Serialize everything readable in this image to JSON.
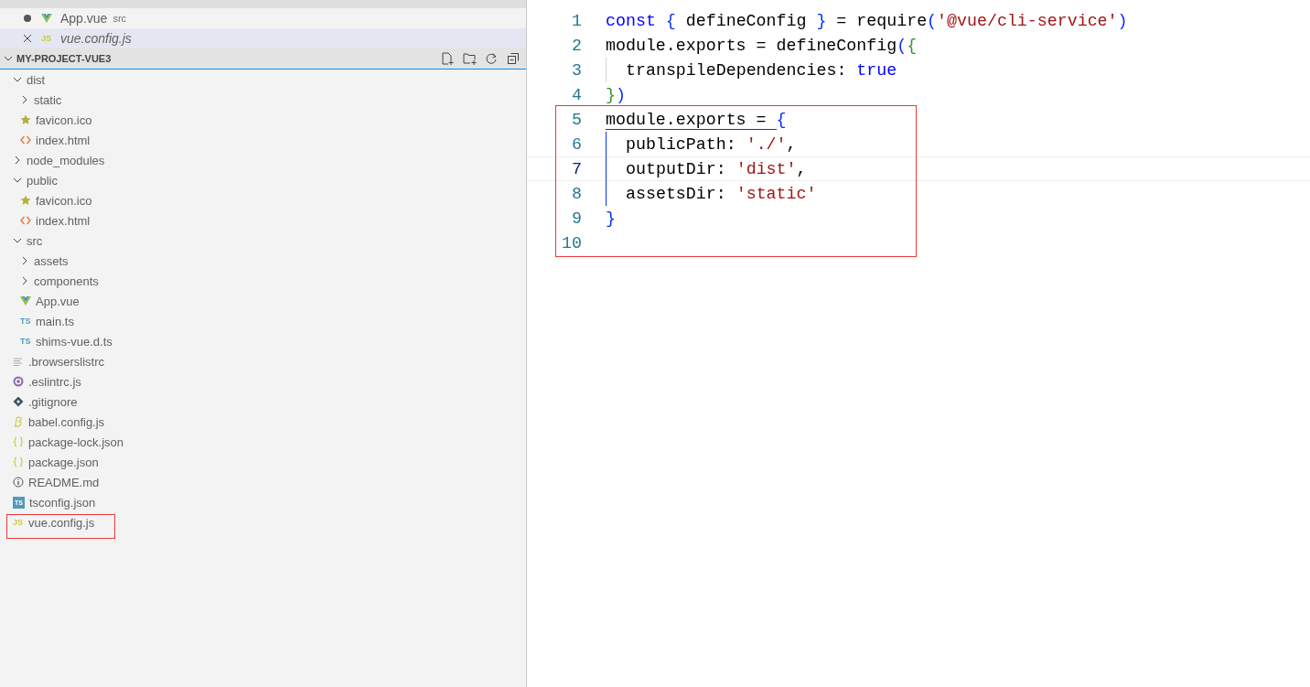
{
  "open_editors": [
    {
      "label": "App.vue",
      "detail": "src",
      "kind": "vue",
      "dirty": true,
      "preview": false,
      "selected": false
    },
    {
      "label": "vue.config.js",
      "kind": "js",
      "icon_text": "JS",
      "dirty": false,
      "preview": true,
      "selected": true
    }
  ],
  "explorer": {
    "title": "MY-PROJECT-VUE3",
    "expanded": true,
    "items": [
      {
        "label": "dist",
        "kind": "folder",
        "expanded": true,
        "children": [
          {
            "label": "static",
            "kind": "folder",
            "expanded": false
          },
          {
            "label": "favicon.ico",
            "kind": "favicon"
          },
          {
            "label": "index.html",
            "kind": "html"
          }
        ]
      },
      {
        "label": "node_modules",
        "kind": "folder",
        "expanded": false
      },
      {
        "label": "public",
        "kind": "folder",
        "expanded": true,
        "children": [
          {
            "label": "favicon.ico",
            "kind": "favicon"
          },
          {
            "label": "index.html",
            "kind": "html"
          }
        ]
      },
      {
        "label": "src",
        "kind": "folder",
        "expanded": true,
        "children": [
          {
            "label": "assets",
            "kind": "folder",
            "expanded": false
          },
          {
            "label": "components",
            "kind": "folder",
            "expanded": false
          },
          {
            "label": "App.vue",
            "kind": "vue"
          },
          {
            "label": "main.ts",
            "kind": "ts",
            "icon_text": "TS"
          },
          {
            "label": "shims-vue.d.ts",
            "kind": "ts",
            "icon_text": "TS"
          }
        ]
      },
      {
        "label": ".browserslistrc",
        "kind": "text"
      },
      {
        "label": ".eslintrc.js",
        "kind": "eslint"
      },
      {
        "label": ".gitignore",
        "kind": "git"
      },
      {
        "label": "babel.config.js",
        "kind": "babel"
      },
      {
        "label": "package-lock.json",
        "kind": "json"
      },
      {
        "label": "package.json",
        "kind": "json"
      },
      {
        "label": "README.md",
        "kind": "info"
      },
      {
        "label": "tsconfig.json",
        "kind": "tsconfig",
        "icon_text": "TS"
      },
      {
        "label": "vue.config.js",
        "kind": "js",
        "icon_text": "JS",
        "annotated": true
      }
    ]
  },
  "editor": {
    "blocks": [
      {
        "lines": [
          {
            "number": "1",
            "indent_guide": false,
            "current": false,
            "tokens": [
              {
                "t": "const ",
                "kind": "keyword"
              },
              {
                "t": "{",
                "kind": "bracket1"
              },
              {
                "t": " defineConfig ",
                "kind": "plain"
              },
              {
                "t": "}",
                "kind": "bracket1"
              },
              {
                "t": " = require",
                "kind": "plain"
              },
              {
                "t": "(",
                "kind": "bracket1"
              },
              {
                "t": "'@vue/cli-service'",
                "kind": "string"
              },
              {
                "t": ")",
                "kind": "bracket1"
              }
            ]
          },
          {
            "number": "2",
            "indent_guide": false,
            "current": false,
            "tokens": [
              {
                "t": "module.exports = defineConfig",
                "kind": "plain"
              },
              {
                "t": "(",
                "kind": "bracket1"
              },
              {
                "t": "{",
                "kind": "bracket2"
              }
            ]
          },
          {
            "number": "3",
            "indent_guide": true,
            "guide_active": false,
            "current": false,
            "tokens": [
              {
                "t": "transpileDependencies: ",
                "kind": "plain"
              },
              {
                "t": "true",
                "kind": "keyword"
              }
            ]
          },
          {
            "number": "4",
            "indent_guide": false,
            "current": false,
            "tokens": [
              {
                "t": "}",
                "kind": "bracket2"
              },
              {
                "t": ")",
                "kind": "bracket1"
              }
            ]
          }
        ]
      },
      {
        "annotated": true,
        "lines": [
          {
            "number": "5",
            "indent_guide": false,
            "current": false,
            "tokens": [
              {
                "t": "module.exports = ",
                "kind": "pairguide"
              },
              {
                "t": "{",
                "kind": "bracket1"
              }
            ]
          },
          {
            "number": "6",
            "indent_guide": true,
            "guide_active": true,
            "current": false,
            "tokens": [
              {
                "t": "publicPath: ",
                "kind": "plain"
              },
              {
                "t": "'./'",
                "kind": "string"
              },
              {
                "t": ",",
                "kind": "plain"
              }
            ]
          },
          {
            "number": "7",
            "indent_guide": true,
            "guide_active": true,
            "current": true,
            "tokens": [
              {
                "t": "outputDir: ",
                "kind": "plain"
              },
              {
                "t": "'dist'",
                "kind": "string"
              },
              {
                "t": ",",
                "kind": "plain"
              }
            ]
          },
          {
            "number": "8",
            "indent_guide": true,
            "guide_active": true,
            "current": false,
            "tokens": [
              {
                "t": "assetsDir: ",
                "kind": "plain"
              },
              {
                "t": "'static'",
                "kind": "string"
              }
            ]
          },
          {
            "number": "9",
            "indent_guide": false,
            "current": false,
            "tokens": [
              {
                "t": "}",
                "kind": "bracket1"
              }
            ]
          },
          {
            "number": "10",
            "indent_guide": false,
            "current": false
          }
        ]
      }
    ]
  }
}
